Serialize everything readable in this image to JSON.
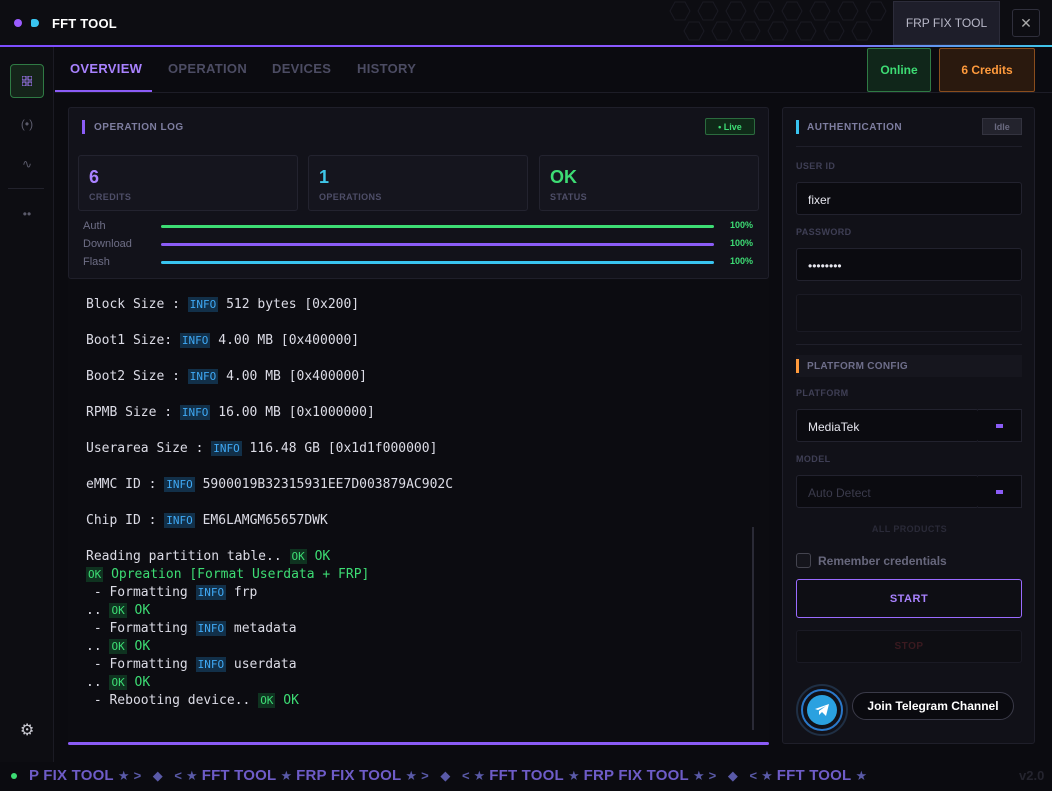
{
  "app": {
    "title": "FFT TOOL",
    "tab_label": "FRP FIX TOOL",
    "close_glyph": "✕"
  },
  "rail": {
    "icons": [
      "grid-icon",
      "wireless-icon",
      "pulse-icon",
      "more-icon",
      "settings-icon"
    ]
  },
  "tabs": [
    {
      "label": "OVERVIEW",
      "active": true
    },
    {
      "label": "OPERATION",
      "active": false
    },
    {
      "label": "DEVICES",
      "active": false
    },
    {
      "label": "HISTORY",
      "active": false
    }
  ],
  "status": {
    "online": "Online",
    "credits": "6 Credits"
  },
  "oplog": {
    "title": "OPERATION LOG",
    "live": "• Live",
    "stats": [
      {
        "value": "6",
        "label": "CREDITS",
        "color": "#a982ff"
      },
      {
        "value": "1",
        "label": "OPERATIONS",
        "color": "#3fc6e8"
      },
      {
        "value": "OK",
        "label": "STATUS",
        "color": "#3ddc74"
      }
    ],
    "progress": [
      {
        "label": "Auth",
        "pct": "100%",
        "value": 1.0,
        "color": "#3ddc74"
      },
      {
        "label": "Download",
        "pct": "100%",
        "value": 1.0,
        "color": "#8b5cf6"
      },
      {
        "label": "Flash",
        "pct": "100%",
        "value": 1.0,
        "color": "#39c4f0"
      }
    ]
  },
  "log": {
    "info": "INFO",
    "ok": "OK",
    "entries": {
      "block_label": "Block Size : ",
      "block_val": " 512 bytes [0x200]",
      "boot1_label": "Boot1 Size: ",
      "boot1_val": " 4.00 MB [0x400000]",
      "boot2_label": "Boot2 Size : ",
      "boot2_val": " 4.00 MB [0x400000]",
      "rpmb_label": "RPMB Size : ",
      "rpmb_val": " 16.00 MB [0x1000000]",
      "user_label": "Userarea Size : ",
      "user_val": " 116.48 GB [0x1d1f000000]",
      "emmc_label": "eMMC ID : ",
      "emmc_val": " 5900019B32315931EE7D003879AC902C",
      "chip_label": "Chip ID : ",
      "chip_val": " EM6LAMGM65657DWK",
      "reading": "Reading partition table.. ",
      "ok_text": " OK",
      "operation": " Opreation [Format Userdata + FRP]",
      "fmt1": " - Formatting ",
      "fmt1_val": " frp",
      "dots": ".. ",
      "fmt2": " - Formatting ",
      "fmt2_val": " metadata",
      "fmt3": " - Formatting ",
      "fmt3_val": " userdata",
      "reboot": " - Rebooting device.. "
    }
  },
  "auth": {
    "title": "AUTHENTICATION",
    "state": "Idle",
    "user_label": "USER ID",
    "user_value": "fixer",
    "pass_label": "PASSWORD",
    "pass_value": "••••••••",
    "platform_title": "PLATFORM CONFIG",
    "platform_label": "PLATFORM",
    "platform_value": "MediaTek",
    "model_label": "MODEL",
    "model_placeholder": "Auto Detect",
    "all_products": "ALL PRODUCTS",
    "remember": "Remember credentials",
    "start": "START",
    "stop": "STOP",
    "telegram": "Join Telegram Channel"
  },
  "footer": {
    "marquee_a": "FRP FIX TOOL",
    "marquee_b": "FFT TOOL",
    "marquee_lead": "P FIX TOOL",
    "version": "v2.0"
  }
}
